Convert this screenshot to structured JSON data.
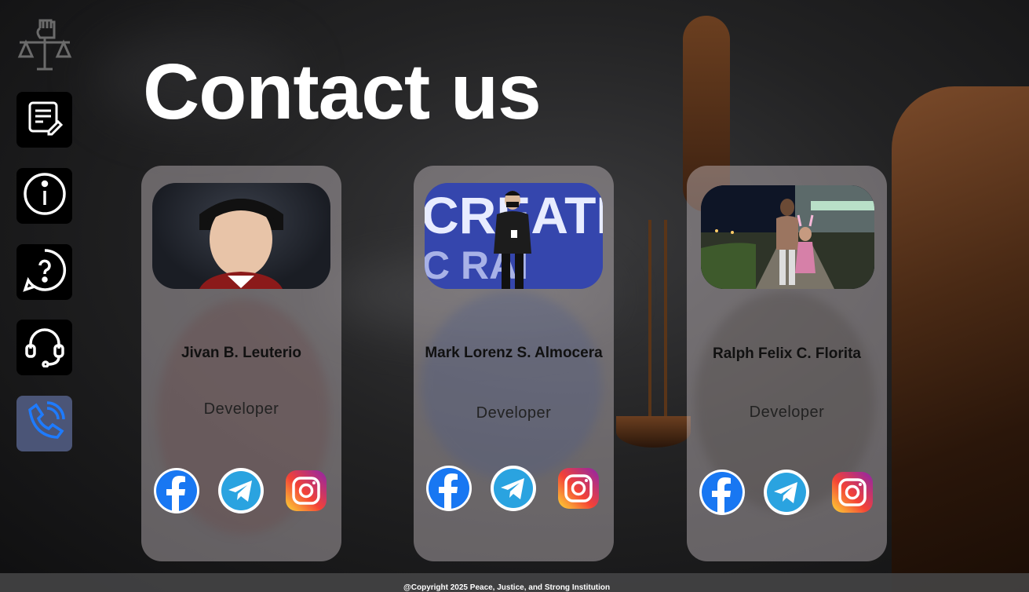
{
  "page": {
    "title": "Contact us"
  },
  "sidebar": {
    "logo": "justice-fist-scales-icon",
    "items": [
      {
        "icon": "document-edit-icon",
        "label": ""
      },
      {
        "icon": "info-icon",
        "label": ""
      },
      {
        "icon": "question-bubble-icon",
        "label": ""
      },
      {
        "icon": "headset-support-icon",
        "label": ""
      },
      {
        "icon": "phone-call-icon",
        "label": "",
        "active": true
      }
    ]
  },
  "cards": [
    {
      "name": "Jivan B. Leuterio",
      "role": "Developer"
    },
    {
      "name": "Mark Lorenz S. Almocera",
      "role": "Developer"
    },
    {
      "name": "Ralph Felix C. Florita",
      "role": "Developer"
    }
  ],
  "socials": [
    "facebook-icon",
    "telegram-icon",
    "instagram-icon"
  ],
  "footer": {
    "copyright": "@Copyright 2025  Peace, Justice, and Strong Institution"
  },
  "colors": {
    "active_nav": "#4b5577",
    "facebook": "#1877f2",
    "telegram": "#2aa3e0",
    "card_bg": "rgba(210,200,205,0.42)"
  }
}
